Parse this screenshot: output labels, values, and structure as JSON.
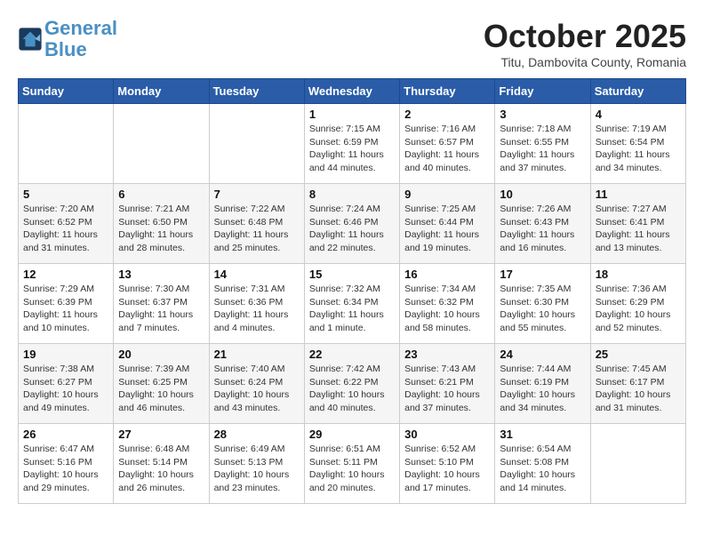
{
  "header": {
    "logo_line1": "General",
    "logo_line2": "Blue",
    "month": "October 2025",
    "location": "Titu, Dambovita County, Romania"
  },
  "days_of_week": [
    "Sunday",
    "Monday",
    "Tuesday",
    "Wednesday",
    "Thursday",
    "Friday",
    "Saturday"
  ],
  "weeks": [
    [
      {
        "day": "",
        "info": ""
      },
      {
        "day": "",
        "info": ""
      },
      {
        "day": "",
        "info": ""
      },
      {
        "day": "1",
        "info": "Sunrise: 7:15 AM\nSunset: 6:59 PM\nDaylight: 11 hours and 44 minutes."
      },
      {
        "day": "2",
        "info": "Sunrise: 7:16 AM\nSunset: 6:57 PM\nDaylight: 11 hours and 40 minutes."
      },
      {
        "day": "3",
        "info": "Sunrise: 7:18 AM\nSunset: 6:55 PM\nDaylight: 11 hours and 37 minutes."
      },
      {
        "day": "4",
        "info": "Sunrise: 7:19 AM\nSunset: 6:54 PM\nDaylight: 11 hours and 34 minutes."
      }
    ],
    [
      {
        "day": "5",
        "info": "Sunrise: 7:20 AM\nSunset: 6:52 PM\nDaylight: 11 hours and 31 minutes."
      },
      {
        "day": "6",
        "info": "Sunrise: 7:21 AM\nSunset: 6:50 PM\nDaylight: 11 hours and 28 minutes."
      },
      {
        "day": "7",
        "info": "Sunrise: 7:22 AM\nSunset: 6:48 PM\nDaylight: 11 hours and 25 minutes."
      },
      {
        "day": "8",
        "info": "Sunrise: 7:24 AM\nSunset: 6:46 PM\nDaylight: 11 hours and 22 minutes."
      },
      {
        "day": "9",
        "info": "Sunrise: 7:25 AM\nSunset: 6:44 PM\nDaylight: 11 hours and 19 minutes."
      },
      {
        "day": "10",
        "info": "Sunrise: 7:26 AM\nSunset: 6:43 PM\nDaylight: 11 hours and 16 minutes."
      },
      {
        "day": "11",
        "info": "Sunrise: 7:27 AM\nSunset: 6:41 PM\nDaylight: 11 hours and 13 minutes."
      }
    ],
    [
      {
        "day": "12",
        "info": "Sunrise: 7:29 AM\nSunset: 6:39 PM\nDaylight: 11 hours and 10 minutes."
      },
      {
        "day": "13",
        "info": "Sunrise: 7:30 AM\nSunset: 6:37 PM\nDaylight: 11 hours and 7 minutes."
      },
      {
        "day": "14",
        "info": "Sunrise: 7:31 AM\nSunset: 6:36 PM\nDaylight: 11 hours and 4 minutes."
      },
      {
        "day": "15",
        "info": "Sunrise: 7:32 AM\nSunset: 6:34 PM\nDaylight: 11 hours and 1 minute."
      },
      {
        "day": "16",
        "info": "Sunrise: 7:34 AM\nSunset: 6:32 PM\nDaylight: 10 hours and 58 minutes."
      },
      {
        "day": "17",
        "info": "Sunrise: 7:35 AM\nSunset: 6:30 PM\nDaylight: 10 hours and 55 minutes."
      },
      {
        "day": "18",
        "info": "Sunrise: 7:36 AM\nSunset: 6:29 PM\nDaylight: 10 hours and 52 minutes."
      }
    ],
    [
      {
        "day": "19",
        "info": "Sunrise: 7:38 AM\nSunset: 6:27 PM\nDaylight: 10 hours and 49 minutes."
      },
      {
        "day": "20",
        "info": "Sunrise: 7:39 AM\nSunset: 6:25 PM\nDaylight: 10 hours and 46 minutes."
      },
      {
        "day": "21",
        "info": "Sunrise: 7:40 AM\nSunset: 6:24 PM\nDaylight: 10 hours and 43 minutes."
      },
      {
        "day": "22",
        "info": "Sunrise: 7:42 AM\nSunset: 6:22 PM\nDaylight: 10 hours and 40 minutes."
      },
      {
        "day": "23",
        "info": "Sunrise: 7:43 AM\nSunset: 6:21 PM\nDaylight: 10 hours and 37 minutes."
      },
      {
        "day": "24",
        "info": "Sunrise: 7:44 AM\nSunset: 6:19 PM\nDaylight: 10 hours and 34 minutes."
      },
      {
        "day": "25",
        "info": "Sunrise: 7:45 AM\nSunset: 6:17 PM\nDaylight: 10 hours and 31 minutes."
      }
    ],
    [
      {
        "day": "26",
        "info": "Sunrise: 6:47 AM\nSunset: 5:16 PM\nDaylight: 10 hours and 29 minutes."
      },
      {
        "day": "27",
        "info": "Sunrise: 6:48 AM\nSunset: 5:14 PM\nDaylight: 10 hours and 26 minutes."
      },
      {
        "day": "28",
        "info": "Sunrise: 6:49 AM\nSunset: 5:13 PM\nDaylight: 10 hours and 23 minutes."
      },
      {
        "day": "29",
        "info": "Sunrise: 6:51 AM\nSunset: 5:11 PM\nDaylight: 10 hours and 20 minutes."
      },
      {
        "day": "30",
        "info": "Sunrise: 6:52 AM\nSunset: 5:10 PM\nDaylight: 10 hours and 17 minutes."
      },
      {
        "day": "31",
        "info": "Sunrise: 6:54 AM\nSunset: 5:08 PM\nDaylight: 10 hours and 14 minutes."
      },
      {
        "day": "",
        "info": ""
      }
    ]
  ]
}
